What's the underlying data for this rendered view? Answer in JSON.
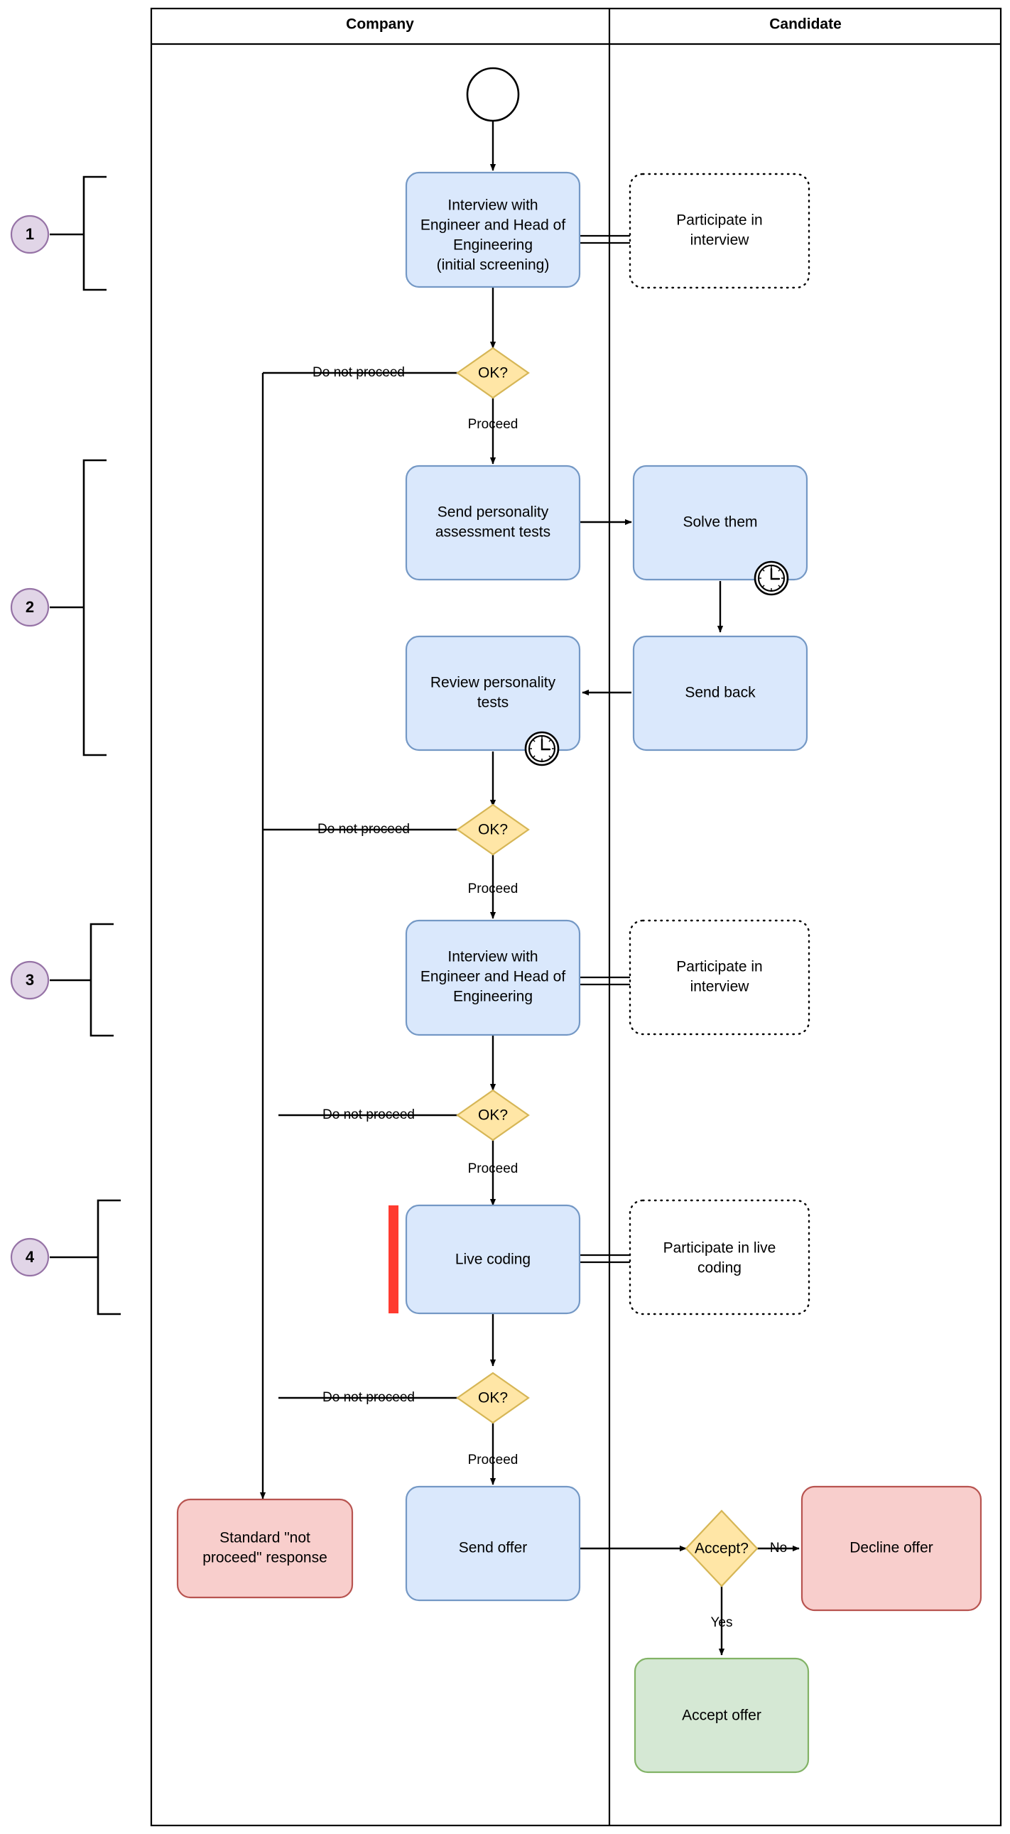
{
  "diagram": {
    "title": "Hiring process swimlane flowchart",
    "lanes": [
      {
        "id": "company",
        "label": "Company"
      },
      {
        "id": "candidate",
        "label": "Candidate"
      }
    ],
    "phase_badges": [
      {
        "id": "phase-1",
        "label": "1"
      },
      {
        "id": "phase-2",
        "label": "2"
      },
      {
        "id": "phase-3",
        "label": "3"
      },
      {
        "id": "phase-4",
        "label": "4"
      }
    ],
    "nodes": {
      "start_event": {
        "type": "start-event",
        "label": ""
      },
      "interview_1": {
        "type": "task",
        "color": "blue",
        "label": "Interview with\nEngineer and Head of\nEngineering\n(initial screening)",
        "lines": [
          "Interview with",
          "Engineer and Head of",
          "Engineering",
          "(initial screening)"
        ]
      },
      "participate_interview_1": {
        "type": "task-dotted",
        "label": "Participate in\ninterview",
        "lines": [
          "Participate in",
          "interview"
        ]
      },
      "gateway_1": {
        "type": "gateway",
        "label": "OK?"
      },
      "send_tests": {
        "type": "task",
        "color": "blue",
        "label": "Send personality\nassessment tests",
        "lines": [
          "Send personality",
          "assessment tests"
        ]
      },
      "solve_them": {
        "type": "task",
        "color": "blue",
        "label": "Solve them",
        "lines": [
          "Solve them"
        ],
        "boundary_event": "timer-icon"
      },
      "review_tests": {
        "type": "task",
        "color": "blue",
        "label": "Review personality\ntests",
        "lines": [
          "Review personality",
          "tests"
        ],
        "boundary_event": "timer-icon"
      },
      "send_back": {
        "type": "task",
        "color": "blue",
        "label": "Send back",
        "lines": [
          "Send back"
        ]
      },
      "gateway_2": {
        "type": "gateway",
        "label": "OK?"
      },
      "interview_2": {
        "type": "task",
        "color": "blue",
        "label": "Interview with\nEngineer and Head of\nEngineering",
        "lines": [
          "Interview with",
          "Engineer and Head of",
          "Engineering"
        ]
      },
      "participate_interview_2": {
        "type": "task-dotted",
        "label": "Participate in\ninterview",
        "lines": [
          "Participate in",
          "interview"
        ]
      },
      "gateway_3": {
        "type": "gateway",
        "label": "OK?"
      },
      "live_coding": {
        "type": "task",
        "color": "blue",
        "label": "Live coding",
        "lines": [
          "Live coding"
        ],
        "marker": "red-bar"
      },
      "participate_live_coding": {
        "type": "task-dotted",
        "label": "Participate in live\ncoding",
        "lines": [
          "Participate in live",
          "coding"
        ]
      },
      "gateway_4": {
        "type": "gateway",
        "label": "OK?"
      },
      "standard_response": {
        "type": "task",
        "color": "red",
        "label": "Standard \"not\nproceed\" response",
        "lines": [
          "Standard \"not",
          "proceed\" response"
        ]
      },
      "send_offer": {
        "type": "task",
        "color": "blue",
        "label": "Send offer",
        "lines": [
          "Send offer"
        ]
      },
      "accept_gateway": {
        "type": "gateway",
        "label": "Accept?"
      },
      "decline_offer": {
        "type": "task",
        "color": "red",
        "label": "Decline offer",
        "lines": [
          "Decline offer"
        ]
      },
      "accept_offer": {
        "type": "task",
        "color": "green",
        "label": "Accept offer",
        "lines": [
          "Accept offer"
        ]
      }
    },
    "edge_labels": {
      "do_not_proceed_1": "Do not proceed",
      "proceed_1": "Proceed",
      "do_not_proceed_2": "Do not proceed",
      "proceed_2": "Proceed",
      "do_not_proceed_3": "Do not proceed",
      "proceed_3": "Proceed",
      "do_not_proceed_4": "Do not proceed",
      "proceed_4": "Proceed",
      "accept_no": "No",
      "accept_yes": "Yes"
    },
    "colors": {
      "task_blue_fill": "#dae8fc",
      "task_blue_stroke": "#7498c5",
      "task_red_fill": "#f8cecc",
      "task_red_stroke": "#b85450",
      "task_green_fill": "#d5e8d4",
      "task_green_stroke": "#82b366",
      "gateway_fill": "#ffe6a6",
      "gateway_stroke": "#d6b656",
      "badge_fill": "#e1d5e7",
      "badge_stroke": "#9673a6",
      "marker_red": "#ff3b30",
      "line": "#000000"
    }
  }
}
